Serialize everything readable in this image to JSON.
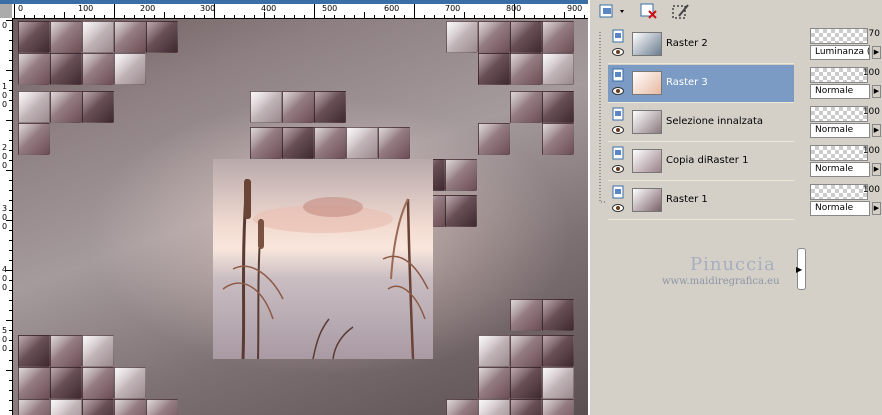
{
  "ruler": {
    "top_ticks": [
      "0",
      "100",
      "200",
      "300",
      "400",
      "500",
      "600",
      "700",
      "800",
      "900"
    ],
    "left_ticks": [
      [
        "0"
      ],
      [
        "1",
        "0",
        "0"
      ],
      [
        "2",
        "0",
        "0"
      ],
      [
        "3",
        "0",
        "0"
      ],
      [
        "4",
        "0",
        "0"
      ],
      [
        "5",
        "0",
        "0"
      ]
    ]
  },
  "watermark": {
    "name": "Pinuccia",
    "url": "www.maidiregrafica.eu"
  },
  "layers": [
    {
      "name": "Raster 2",
      "opacity": "70",
      "blend": "Luminanza (L)",
      "selected": false,
      "thumb": "#6b7c90"
    },
    {
      "name": "Raster 3",
      "opacity": "100",
      "blend": "Normale",
      "selected": true,
      "thumb": "#e8b8a0"
    },
    {
      "name": "Selezione innalzata",
      "opacity": "100",
      "blend": "Normale",
      "selected": false,
      "thumb": "#8a7a80"
    },
    {
      "name": "Copia diRaster 1",
      "opacity": "100",
      "blend": "Normale",
      "selected": false,
      "thumb": "#9a8088"
    },
    {
      "name": "Raster 1",
      "opacity": "100",
      "blend": "Normale",
      "selected": false,
      "thumb": "#7a6068"
    }
  ],
  "colors": {
    "selection": "#7b9ac4",
    "panel": "#d4d0c8"
  }
}
